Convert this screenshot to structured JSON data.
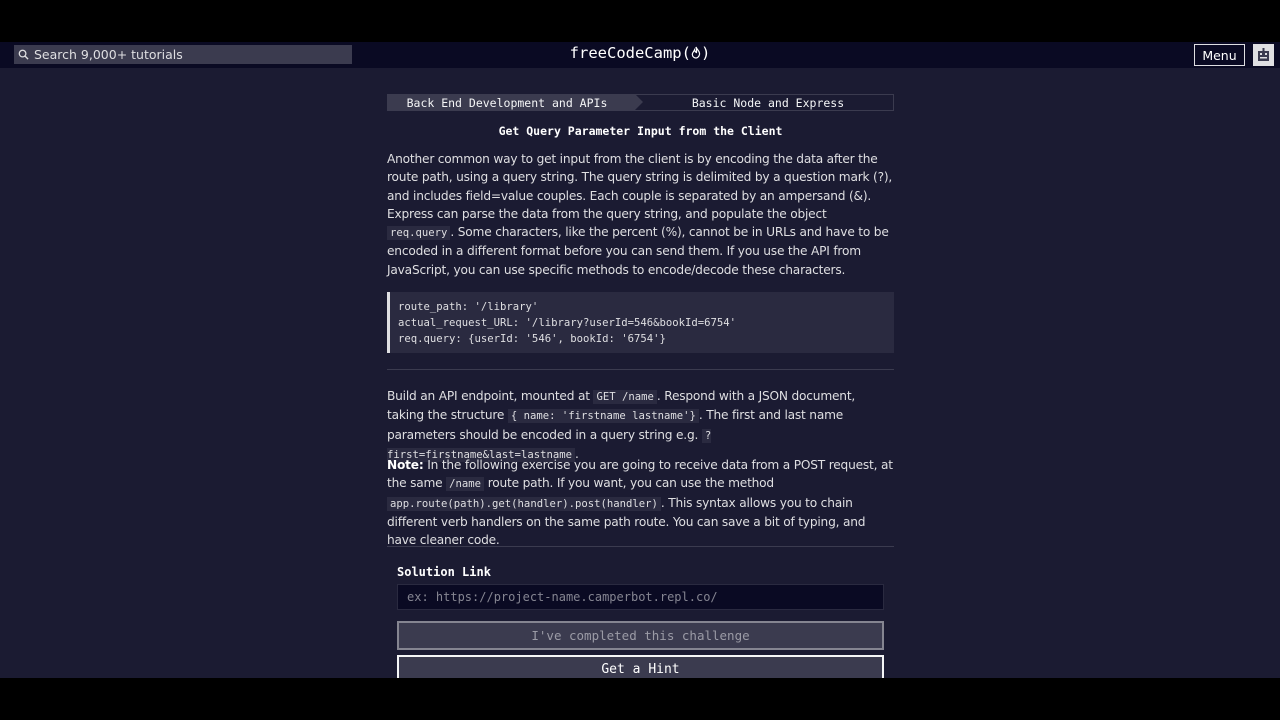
{
  "nav": {
    "search_placeholder": "Search 9,000+ tutorials",
    "logo_text": "freeCodeCamp(",
    "logo_flame": "🔥",
    "logo_close": ")",
    "menu_label": "Menu"
  },
  "breadcrumb": {
    "superblock": "Back End Development and APIs",
    "block": "Basic Node and Express"
  },
  "challenge": {
    "title": "Get Query Parameter Input from the Client",
    "intro": {
      "t1": "Another common way to get input from the client is by encoding the data after the route path, using a query string. The query string is delimited by a question mark (?), and includes field=value couples. Each couple is separated by an ampersand (&). Express can parse the data from the query string, and populate the object ",
      "c1": "req.query",
      "t2": ". Some characters, like the percent (%), cannot be in URLs and have to be encoded in a different format before you can send them. If you use the API from JavaScript, you can use specific methods to encode/decode these characters."
    },
    "code_lines": [
      "route_path: '/library'",
      "actual_request_URL: '/library?userId=546&bookId=6754'",
      "req.query: {userId: '546', bookId: '6754'}"
    ],
    "task": {
      "t1": "Build an API endpoint, mounted at ",
      "c1": "GET /name",
      "t2": ". Respond with a JSON document, taking the structure ",
      "c2": "{ name: 'firstname lastname'}",
      "t3": ". The first and last name parameters should be encoded in a query string e.g. ",
      "c3": "?first=firstname&last=lastname",
      "t4": "."
    },
    "note": {
      "label": "Note:",
      "t1": " In the following exercise you are going to receive data from a POST request, at the same ",
      "c1": "/name",
      "t2": " route path. If you want, you can use the method ",
      "c2": "app.route(path).get(handler).post(handler)",
      "t3": ". This syntax allows you to chain different verb handlers on the same path route. You can save a bit of typing, and have cleaner code."
    }
  },
  "form": {
    "solution_label": "Solution Link",
    "solution_placeholder": "ex: https://project-name.camperbot.repl.co/",
    "complete_button": "I've completed this challenge",
    "hint_button": "Get a Hint"
  }
}
